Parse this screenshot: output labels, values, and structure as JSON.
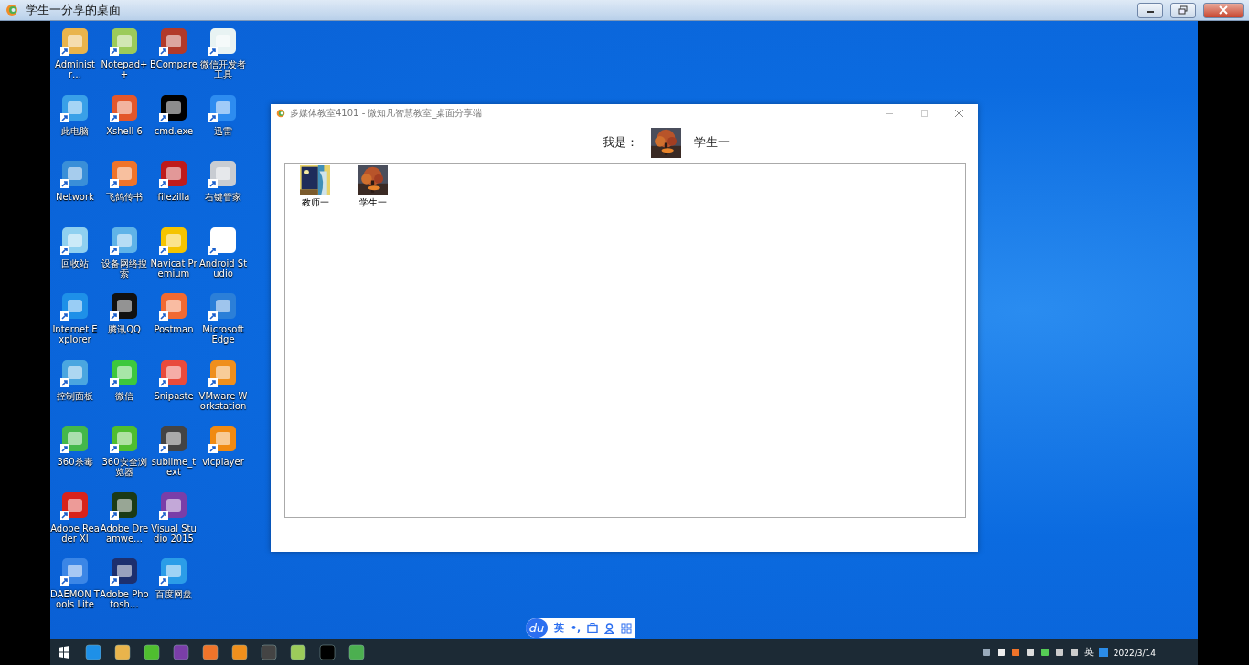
{
  "window": {
    "title": "学生一分享的桌面"
  },
  "desktop": {
    "icons": [
      {
        "label": "Administr…"
      },
      {
        "label": "此电脑"
      },
      {
        "label": "Network"
      },
      {
        "label": "回收站"
      },
      {
        "label": "Internet Explorer"
      },
      {
        "label": "控制面板"
      },
      {
        "label": "360杀毒"
      },
      {
        "label": "Adobe Reader XI"
      },
      {
        "label": "DAEMON Tools Lite"
      },
      {
        "label": "Notepad++"
      },
      {
        "label": "Xshell 6"
      },
      {
        "label": "飞鸽传书"
      },
      {
        "label": "设备网络搜索"
      },
      {
        "label": "腾讯QQ"
      },
      {
        "label": "微信"
      },
      {
        "label": "360安全浏览器"
      },
      {
        "label": "Adobe Dreamwe…"
      },
      {
        "label": "Adobe Photosh…"
      },
      {
        "label": "BCompare"
      },
      {
        "label": "cmd.exe"
      },
      {
        "label": "filezilla"
      },
      {
        "label": "Navicat Premium"
      },
      {
        "label": "Postman"
      },
      {
        "label": "Snipaste"
      },
      {
        "label": "sublime_text"
      },
      {
        "label": "Visual Studio 2015"
      },
      {
        "label": "百度网盘"
      },
      {
        "label": "微信开发者工具"
      },
      {
        "label": "迅雷"
      },
      {
        "label": "右键管家"
      },
      {
        "label": "Android Studio"
      },
      {
        "label": "Microsoft Edge"
      },
      {
        "label": "VMware Workstation"
      },
      {
        "label": "vlcplayer"
      }
    ]
  },
  "share_window": {
    "title": "多媒体教室4101 - 微知凡智慧教室_桌面分享端",
    "me_label": "我是：",
    "me_name": "学生一",
    "members": [
      {
        "name": "教师一"
      },
      {
        "name": "学生一"
      }
    ]
  },
  "ime_bar": {
    "logo": "du",
    "mode": "英",
    "punct": "•,"
  },
  "taskbar": {
    "ime": "英",
    "date": "2022/3/14"
  }
}
